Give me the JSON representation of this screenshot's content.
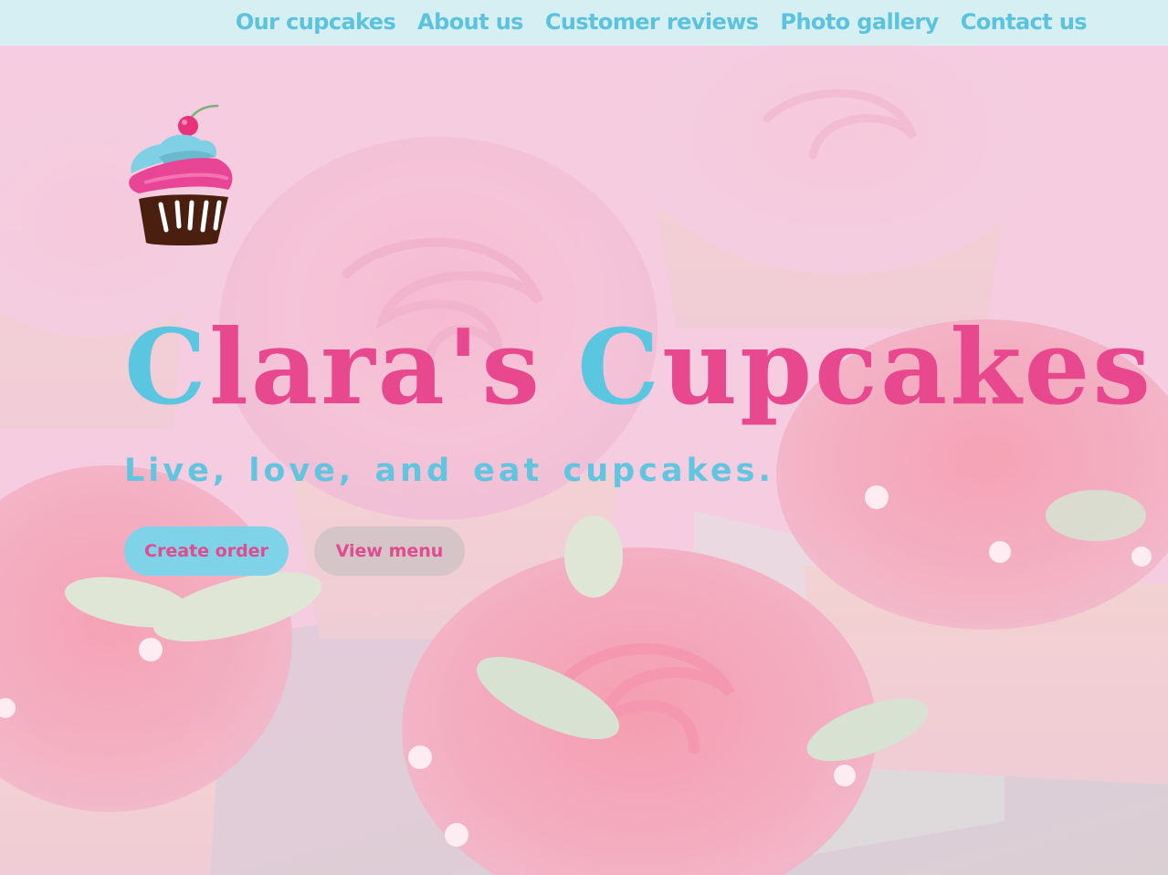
{
  "nav": {
    "links": [
      {
        "label": "Our cupcakes"
      },
      {
        "label": "About us"
      },
      {
        "label": "Customer reviews"
      },
      {
        "label": "Photo gallery"
      },
      {
        "label": "Contact us"
      }
    ]
  },
  "hero": {
    "title_word1_initial": "C",
    "title_word1_rest": "lara's",
    "title_word2_initial": "C",
    "title_word2_rest": "upcakes",
    "tagline": "Live, love, and eat cupcakes.",
    "primary_button": "Create order",
    "secondary_button": "View menu"
  },
  "colors": {
    "nav_background": "#d5eff2",
    "nav_link": "#5bc3de",
    "brand_pink": "#e8488e",
    "brand_blue": "#5bc6e0",
    "primary_button_bg": "#7ed3e8",
    "secondary_button_bg": "#c8c8c8",
    "hero_overlay": "#f4c3dc"
  },
  "icons": {
    "logo": "cupcake-logo-icon",
    "background": "cupcakes-photo-background"
  }
}
